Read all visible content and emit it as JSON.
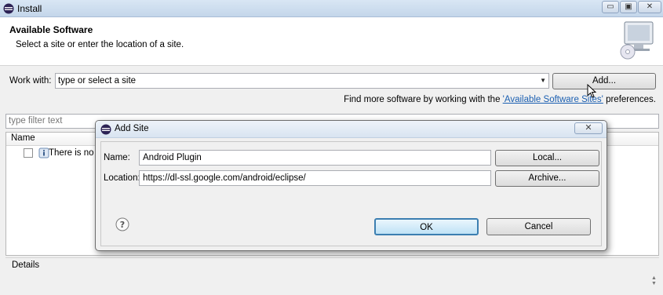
{
  "window": {
    "title": "Install",
    "controls": {
      "minimize": "▭",
      "maximize": "▣",
      "close": "✕"
    }
  },
  "banner": {
    "title": "Available Software",
    "subtitle": "Select a site or enter the location of a site."
  },
  "work_with": {
    "label": "Work with:",
    "value": "type or select a site",
    "add_button": "Add..."
  },
  "find_more": {
    "prefix": "Find more software by working with the ",
    "link": "'Available Software Sites'",
    "suffix": " preferences."
  },
  "filter": {
    "placeholder": "type filter text"
  },
  "table": {
    "column_name": "Name",
    "rows": [
      {
        "text": "There is no s"
      }
    ]
  },
  "details": {
    "label": "Details"
  },
  "dialog": {
    "title": "Add Site",
    "close": "✕",
    "name_label": "Name:",
    "name_value": "Android Plugin",
    "location_label": "Location:",
    "location_value": "https://dl-ssl.google.com/android/eclipse/",
    "local_button": "Local...",
    "archive_button": "Archive...",
    "ok_button": "OK",
    "cancel_button": "Cancel"
  },
  "icons": {
    "app": "eclipse-icon",
    "banner": "monitor-cd-icon",
    "help": "help-icon",
    "cursor": "mouse-cursor-icon"
  },
  "colors": {
    "link": "#1b5fb1",
    "title_bar": "#c4d6ea",
    "ok_focus": "#3c7fb1"
  }
}
